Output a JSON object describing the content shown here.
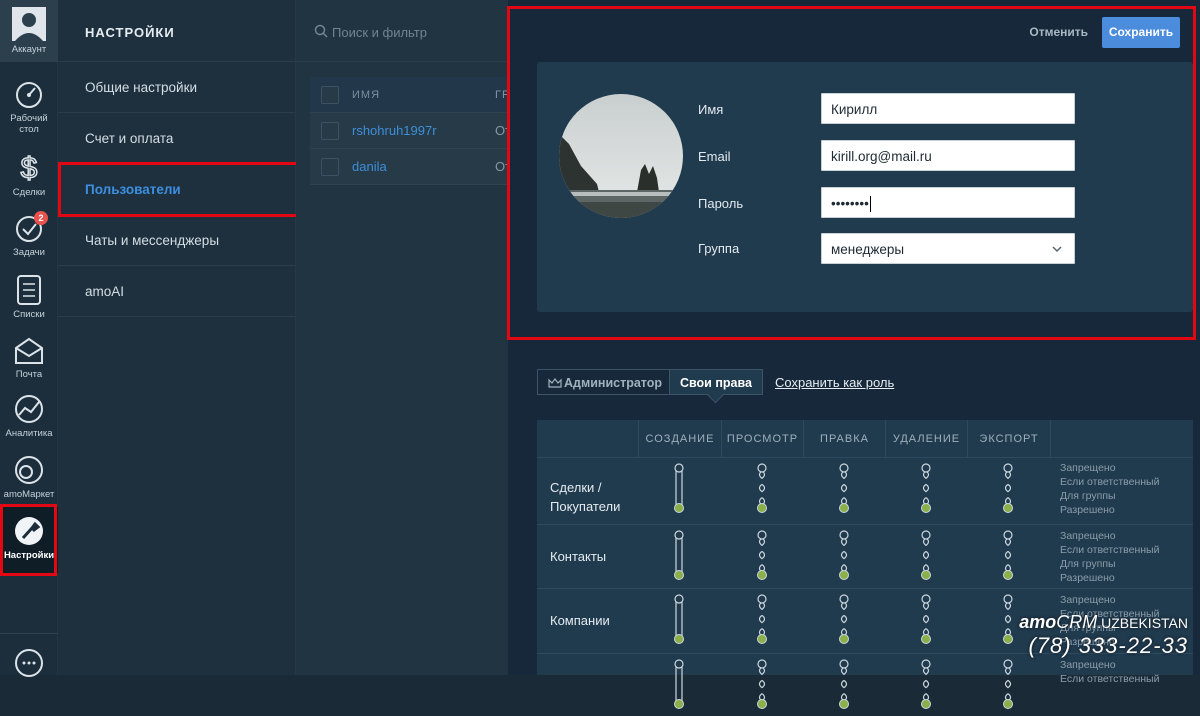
{
  "rail": {
    "account": "Аккаунт",
    "items": [
      {
        "label": "Рабочий стол",
        "icon": "dashboard-icon"
      },
      {
        "label": "Сделки",
        "icon": "dollar-icon"
      },
      {
        "label": "Задачи",
        "icon": "checkmark-icon",
        "badge": "2"
      },
      {
        "label": "Списки",
        "icon": "list-icon"
      },
      {
        "label": "Почта",
        "icon": "mail-icon"
      },
      {
        "label": "Аналитика",
        "icon": "analytics-icon"
      },
      {
        "label": "amoМаркет",
        "icon": "market-icon"
      },
      {
        "label": "Настройки",
        "icon": "wrench-icon"
      }
    ],
    "chat_icon": "chat-bubble-icon"
  },
  "settings": {
    "title": "НАСТРОЙКИ",
    "menu": [
      "Общие настройки",
      "Счет и оплата",
      "Пользователи",
      "Чаты и мессенджеры",
      "amoAI"
    ],
    "active_index": 2
  },
  "users": {
    "search_placeholder": "Поиск и фильтр",
    "columns": [
      "ИМЯ",
      "ГР"
    ],
    "rows": [
      {
        "name": "rshohruh1997r",
        "group": "От"
      },
      {
        "name": "danila",
        "group": "От"
      }
    ]
  },
  "edit": {
    "cancel": "Отменить",
    "save": "Сохранить",
    "fields": {
      "name_label": "Имя",
      "name_value": "Кирилл",
      "email_label": "Email",
      "email_value": "kirill.org@mail.ru",
      "password_label": "Пароль",
      "password_value": "••••••••",
      "group_label": "Группа",
      "group_value": "менеджеры"
    }
  },
  "roles": {
    "admin_tab": "Администратор",
    "own_tab": "Свои права",
    "save_as_role": "Сохранить как роль"
  },
  "rights": {
    "columns": [
      "СОЗДАНИЕ",
      "ПРОСМОТР",
      "ПРАВКА",
      "УДАЛЕНИЕ",
      "ЭКСПОРТ"
    ],
    "rows": [
      "Сделки / Покупатели",
      "Контакты",
      "Компании",
      ""
    ],
    "legend": [
      "Запрещено",
      "Если ответственный",
      "Для группы",
      "Разрешено"
    ],
    "slider_level": "Разрешено"
  },
  "watermark": {
    "brand_amo": "amo",
    "brand_crm": "CRM",
    "brand_suffix": ".UZBEKISTAN",
    "phone": "(78) 333-22-33"
  },
  "colors": {
    "accent": "#4b8cdd",
    "active_link": "#3c8fe0",
    "highlight": "#e30613",
    "slider_dot": "#8bb04b"
  }
}
